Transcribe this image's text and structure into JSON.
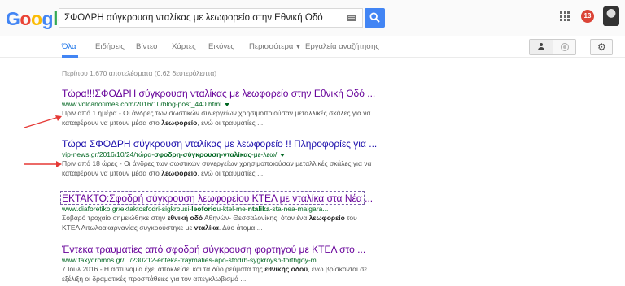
{
  "logo": {
    "letters": [
      "G",
      "o",
      "o",
      "g",
      "l",
      "e"
    ],
    "colors": [
      "#4285f4",
      "#ea4335",
      "#fbbc05",
      "#4285f4",
      "#34a853",
      "#ea4335"
    ]
  },
  "search": {
    "query": "ΣΦΟΔΡΗ σύγκρουση νταλίκας με λεωφορείο στην Εθνική Οδό"
  },
  "header": {
    "notifications": "13"
  },
  "tabs": [
    {
      "label": "Όλα"
    },
    {
      "label": "Ειδήσεις"
    },
    {
      "label": "Βίντεο"
    },
    {
      "label": "Χάρτες"
    },
    {
      "label": "Εικόνες"
    },
    {
      "label": "Περισσότερα"
    },
    {
      "label": "Εργαλεία αναζήτησης"
    }
  ],
  "stats": "Περίπου 1.670 αποτελέσματα (0,62 δευτερόλεπτα)",
  "results": [
    {
      "title": "Τώρα!!!ΣΦΟΔΡΗ σύγκρουση νταλίκας με λεωφορείο στην Εθνική Οδό ...",
      "url": "www.volcanotimes.com/2016/10/blog-post_440.html",
      "snippet_line1": "Πριν από 1 ημέρα - Οι άνδρες των σωστικών συνεργείων χρησιμοποιούσαν μεταλλικές σκάλες για να",
      "snippet_line2_pre": "καταφέρουν να μπουν μέσα στο ",
      "snippet_line2_bold": "λεωφορείο",
      "snippet_line2_post": ", ενώ οι τραυματίες ..."
    },
    {
      "title": "Τώρα ΣΦΟΔΡΗ σύγκρουση νταλίκας με λεωφορείο !! Πληροφορίες για ...",
      "url_pre": "vip-news.gr/2016/10/24/τώρα-",
      "url_bold": "σφοδρη-σύγκρουση-νταλίκας",
      "url_post": "-με-λεω/",
      "snippet_line1": "Πριν από 18 ώρες - Οι άνδρες των σωστικών συνεργείων χρησιμοποιούσαν μεταλλικές σκάλες για να",
      "snippet_line2_pre": "καταφέρουν να μπουν μέσα στο ",
      "snippet_line2_bold": "λεωφορείο",
      "snippet_line2_post": ", ενώ οι τραυματίες ..."
    },
    {
      "title": "ΕΚΤΑΚΤΟ:Σφοδρή σύγκρουση λεωφορείου ΚΤΕΛ με νταλίκα στα Νέα ...",
      "url_pre": "www.diaforetiko.gr/ektaktosfodri-sigkrousi-",
      "url_bold1": "leoforio",
      "url_mid": "u-ktel-me-",
      "url_bold2": "ntalika",
      "url_post": "-sta-nea-malgara...",
      "snippet_line1_pre": "Σοβαρό τροχαίο σημειώθηκε στην ",
      "snippet_line1_bold1": "εθνική οδό",
      "snippet_line1_mid": " Αθηνών- Θεσσαλονίκης, όταν ένα ",
      "snippet_line1_bold2": "λεωφορείο",
      "snippet_line1_post": " του",
      "snippet_line2_pre": "ΚΤΕΛ Αιτωλοακαρνανίας συγκρούστηκε με ",
      "snippet_line2_bold": "νταλίκα",
      "snippet_line2_post": ". Δύο άτομα ..."
    },
    {
      "title": "Έντεκα τραυματίες από σφοδρή σύγκρουση φορτηγού με ΚΤΕΛ στο ...",
      "url": "www.taxydromos.gr/.../230212-enteka-traymaties-apo-sfodrh-sygkroysh-forthgoy-m...",
      "snippet_line1_pre": "7 Ιουλ 2016 - Η αστυνομία έχει αποκλείσει και τα δύο ρεύματα της ",
      "snippet_line1_bold1": "εθνικής οδού",
      "snippet_line1_post": ", ενώ βρίσκονται σε",
      "snippet_line2": "εξέλιξη οι δραματικές προσπάθειες για τον απεγκλωβισμό ..."
    }
  ]
}
